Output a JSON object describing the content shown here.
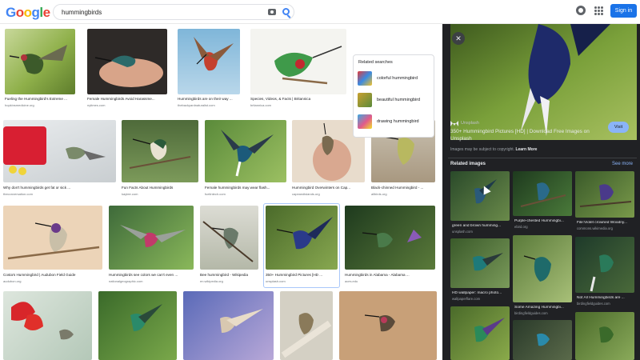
{
  "header": {
    "logo_letters": [
      "G",
      "o",
      "o",
      "g",
      "l",
      "e"
    ],
    "logo_colors": [
      "#4285f4",
      "#ea4335",
      "#fbbc05",
      "#4285f4",
      "#34a853",
      "#ea4335"
    ],
    "search_value": "hummingbirds",
    "sign_in_label": "Sign in",
    "icons": [
      "camera-icon",
      "search-icon",
      "gear-icon",
      "apps-grid-icon"
    ]
  },
  "related_searches": {
    "title": "Related searches",
    "items": [
      {
        "label": "colorful hummingbird"
      },
      {
        "label": "beautiful hummingbird"
      },
      {
        "label": "drawing hummingbird"
      }
    ]
  },
  "results": [
    {
      "caption": "Fueling the Hummingbird's Extreme ...",
      "source": "hopkinsmedicine.org"
    },
    {
      "caption": "Female Hummingbirds Avoid Harassme...",
      "source": "nytimes.com"
    },
    {
      "caption": "Hummingbirds are on their way ...",
      "source": "thebackyardnaturalist.com"
    },
    {
      "caption": "Species, Videos, & Facts | Britannica",
      "source": "britannica.com"
    },
    {
      "caption": "Why don't hummingbirds get fat or sick ...",
      "source": "theconversation.com"
    },
    {
      "caption": "Fun Facts About Hummingbirds",
      "source": "kaytee.com"
    },
    {
      "caption": "Female hummingbirds may wear flash...",
      "source": "fuelintech.com"
    },
    {
      "caption": "Hummingbird Overwinters on Cap...",
      "source": "capeandislands.org"
    },
    {
      "caption": "Black-chinned Hummingbird - ...",
      "source": "allbirds.org"
    },
    {
      "caption": "Costa's Hummingbird | Audubon Field Guide",
      "source": "audubon.org"
    },
    {
      "caption": "Hummingbirds see colors we can't even ...",
      "source": "nationalgeographic.com"
    },
    {
      "caption": "Bee hummingbird - Wikipedia",
      "source": "en.wikipedia.org"
    },
    {
      "caption": "350+ Hummingbird Pictures [HD ...",
      "source": "unsplash.com"
    },
    {
      "caption": "Hummingbirds in Alabama - Alabama ...",
      "source": "aces.edu"
    }
  ],
  "panel": {
    "site": "Unsplash",
    "title": "350+ Hummingbird Pictures [HD] | Download Free Images on Unsplash",
    "visit_label": "Visit",
    "copyright_text": "Images may be subject to copyright.",
    "learn_more": "Learn More",
    "related_heading": "Related images",
    "see_more": "See more",
    "related": [
      {
        "caption": "green and brown humming...",
        "source": "unsplash.com"
      },
      {
        "caption": "Purple-chested Hummingbi...",
        "source": "ebird.org"
      },
      {
        "caption": "File:Violet crowned Woodny...",
        "source": "commons.wikimedia.org"
      },
      {
        "caption": "HD wallpaper: macro photo...",
        "source": "wallpaperflare.com"
      },
      {
        "caption": "Some Amazing Hummingbi...",
        "source": "birdingfieldguides.com"
      },
      {
        "caption": "Not All Hummingbirds are ...",
        "source": "birdingfieldguides.com"
      }
    ]
  }
}
